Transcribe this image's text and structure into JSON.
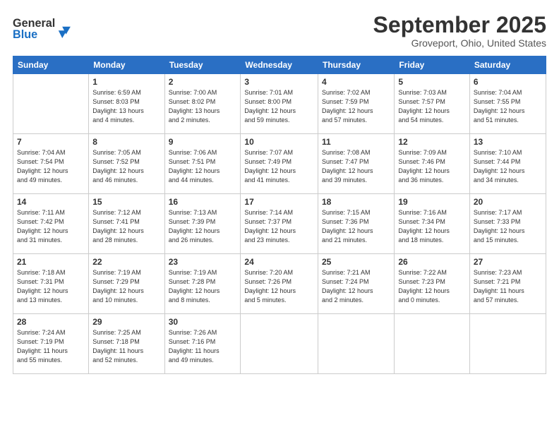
{
  "header": {
    "logo_general": "General",
    "logo_blue": "Blue",
    "month_title": "September 2025",
    "location": "Groveport, Ohio, United States"
  },
  "weekdays": [
    "Sunday",
    "Monday",
    "Tuesday",
    "Wednesday",
    "Thursday",
    "Friday",
    "Saturday"
  ],
  "weeks": [
    [
      {
        "day": "",
        "info": ""
      },
      {
        "day": "1",
        "info": "Sunrise: 6:59 AM\nSunset: 8:03 PM\nDaylight: 13 hours\nand 4 minutes."
      },
      {
        "day": "2",
        "info": "Sunrise: 7:00 AM\nSunset: 8:02 PM\nDaylight: 13 hours\nand 2 minutes."
      },
      {
        "day": "3",
        "info": "Sunrise: 7:01 AM\nSunset: 8:00 PM\nDaylight: 12 hours\nand 59 minutes."
      },
      {
        "day": "4",
        "info": "Sunrise: 7:02 AM\nSunset: 7:59 PM\nDaylight: 12 hours\nand 57 minutes."
      },
      {
        "day": "5",
        "info": "Sunrise: 7:03 AM\nSunset: 7:57 PM\nDaylight: 12 hours\nand 54 minutes."
      },
      {
        "day": "6",
        "info": "Sunrise: 7:04 AM\nSunset: 7:55 PM\nDaylight: 12 hours\nand 51 minutes."
      }
    ],
    [
      {
        "day": "7",
        "info": "Sunrise: 7:04 AM\nSunset: 7:54 PM\nDaylight: 12 hours\nand 49 minutes."
      },
      {
        "day": "8",
        "info": "Sunrise: 7:05 AM\nSunset: 7:52 PM\nDaylight: 12 hours\nand 46 minutes."
      },
      {
        "day": "9",
        "info": "Sunrise: 7:06 AM\nSunset: 7:51 PM\nDaylight: 12 hours\nand 44 minutes."
      },
      {
        "day": "10",
        "info": "Sunrise: 7:07 AM\nSunset: 7:49 PM\nDaylight: 12 hours\nand 41 minutes."
      },
      {
        "day": "11",
        "info": "Sunrise: 7:08 AM\nSunset: 7:47 PM\nDaylight: 12 hours\nand 39 minutes."
      },
      {
        "day": "12",
        "info": "Sunrise: 7:09 AM\nSunset: 7:46 PM\nDaylight: 12 hours\nand 36 minutes."
      },
      {
        "day": "13",
        "info": "Sunrise: 7:10 AM\nSunset: 7:44 PM\nDaylight: 12 hours\nand 34 minutes."
      }
    ],
    [
      {
        "day": "14",
        "info": "Sunrise: 7:11 AM\nSunset: 7:42 PM\nDaylight: 12 hours\nand 31 minutes."
      },
      {
        "day": "15",
        "info": "Sunrise: 7:12 AM\nSunset: 7:41 PM\nDaylight: 12 hours\nand 28 minutes."
      },
      {
        "day": "16",
        "info": "Sunrise: 7:13 AM\nSunset: 7:39 PM\nDaylight: 12 hours\nand 26 minutes."
      },
      {
        "day": "17",
        "info": "Sunrise: 7:14 AM\nSunset: 7:37 PM\nDaylight: 12 hours\nand 23 minutes."
      },
      {
        "day": "18",
        "info": "Sunrise: 7:15 AM\nSunset: 7:36 PM\nDaylight: 12 hours\nand 21 minutes."
      },
      {
        "day": "19",
        "info": "Sunrise: 7:16 AM\nSunset: 7:34 PM\nDaylight: 12 hours\nand 18 minutes."
      },
      {
        "day": "20",
        "info": "Sunrise: 7:17 AM\nSunset: 7:33 PM\nDaylight: 12 hours\nand 15 minutes."
      }
    ],
    [
      {
        "day": "21",
        "info": "Sunrise: 7:18 AM\nSunset: 7:31 PM\nDaylight: 12 hours\nand 13 minutes."
      },
      {
        "day": "22",
        "info": "Sunrise: 7:19 AM\nSunset: 7:29 PM\nDaylight: 12 hours\nand 10 minutes."
      },
      {
        "day": "23",
        "info": "Sunrise: 7:19 AM\nSunset: 7:28 PM\nDaylight: 12 hours\nand 8 minutes."
      },
      {
        "day": "24",
        "info": "Sunrise: 7:20 AM\nSunset: 7:26 PM\nDaylight: 12 hours\nand 5 minutes."
      },
      {
        "day": "25",
        "info": "Sunrise: 7:21 AM\nSunset: 7:24 PM\nDaylight: 12 hours\nand 2 minutes."
      },
      {
        "day": "26",
        "info": "Sunrise: 7:22 AM\nSunset: 7:23 PM\nDaylight: 12 hours\nand 0 minutes."
      },
      {
        "day": "27",
        "info": "Sunrise: 7:23 AM\nSunset: 7:21 PM\nDaylight: 11 hours\nand 57 minutes."
      }
    ],
    [
      {
        "day": "28",
        "info": "Sunrise: 7:24 AM\nSunset: 7:19 PM\nDaylight: 11 hours\nand 55 minutes."
      },
      {
        "day": "29",
        "info": "Sunrise: 7:25 AM\nSunset: 7:18 PM\nDaylight: 11 hours\nand 52 minutes."
      },
      {
        "day": "30",
        "info": "Sunrise: 7:26 AM\nSunset: 7:16 PM\nDaylight: 11 hours\nand 49 minutes."
      },
      {
        "day": "",
        "info": ""
      },
      {
        "day": "",
        "info": ""
      },
      {
        "day": "",
        "info": ""
      },
      {
        "day": "",
        "info": ""
      }
    ]
  ]
}
